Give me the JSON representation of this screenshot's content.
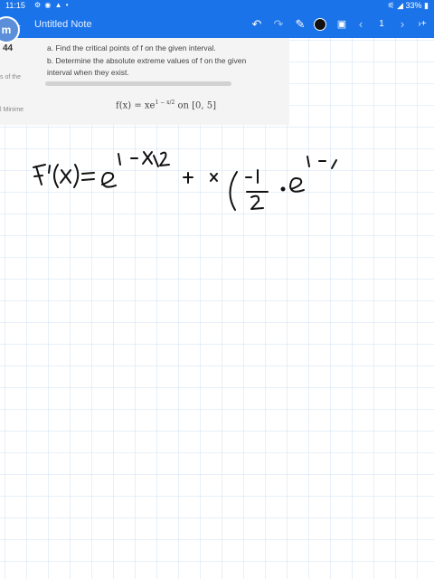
{
  "status_bar": {
    "time": "11:15",
    "battery": "33%"
  },
  "app_bar": {
    "title": "Untitled Note",
    "page_number": "1",
    "icons": [
      "back-arrow-icon",
      "undo-icon",
      "redo-icon",
      "pen-icon",
      "color-swatch-icon",
      "image-icon",
      "chevron-left-icon",
      "chevron-right-icon",
      "add-page-icon"
    ]
  },
  "problem": {
    "number": "44",
    "side_text_1": "s of the",
    "side_text_2": "l Minime",
    "part_a": "a. Find the critical points of f on the given interval.",
    "part_b": "b. Determine the absolute extreme values of f on the given",
    "part_b_cont": "interval when they exist.",
    "formula_lhs": "f(x) = xe",
    "formula_exp": "1 − x/2",
    "formula_rhs": " on [0, 5]"
  },
  "colors": {
    "app_bar": "#1a73e8",
    "grid_line": "#cfe0f3",
    "ink": "#111111"
  }
}
